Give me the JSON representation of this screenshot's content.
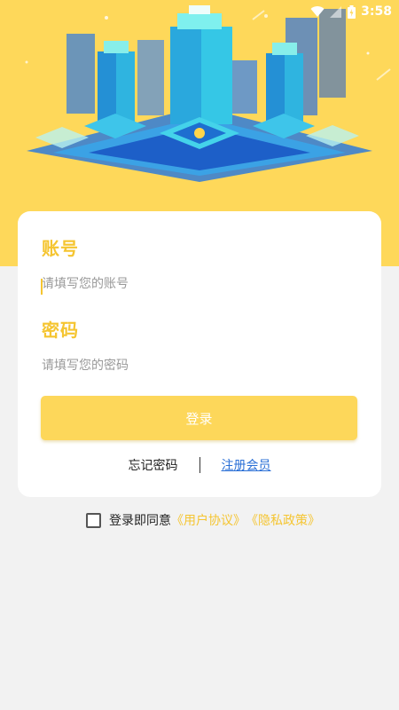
{
  "status_bar": {
    "time": "3:58"
  },
  "login": {
    "account_title": "账号",
    "account_placeholder": "请填写您的账号",
    "password_title": "密码",
    "password_placeholder": "请填写您的密码",
    "login_button": "登录",
    "forgot_password": "忘记密码",
    "register": "注册会员"
  },
  "agreement": {
    "prefix": "登录即同意",
    "user_agreement": "《用户协议》",
    "privacy_policy": "《隐私政策》"
  },
  "colors": {
    "hero_bg": "#fed85a",
    "accent": "#f5c531",
    "link": "#2a6fd6",
    "page_bg": "#f2f2f2"
  }
}
